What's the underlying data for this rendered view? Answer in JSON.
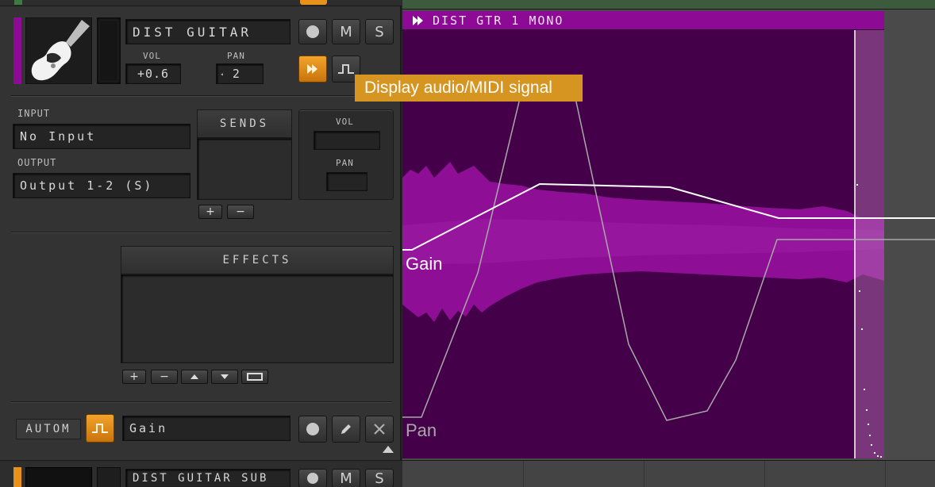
{
  "track": {
    "name": "DIST GUITAR",
    "vol_label": "VOL",
    "vol_value": "+0.6",
    "pan_label": "PAN",
    "pan_value": "2",
    "mute_label": "M",
    "solo_label": "S"
  },
  "tooltip": "Display audio/MIDI signal",
  "io": {
    "input_label": "INPUT",
    "input_value": "No Input",
    "output_label": "OUTPUT",
    "output_value": "Output 1-2 (S)"
  },
  "sends": {
    "title": "SENDS",
    "add": "+",
    "remove": "−",
    "vol_label": "VOL",
    "pan_label": "PAN"
  },
  "effects": {
    "title": "EFFECTS",
    "add": "+",
    "remove": "−"
  },
  "automation": {
    "label": "AUTOM",
    "parameter": "Gain"
  },
  "next_track": {
    "name": "DIST GUITAR SUB",
    "mute_label": "M",
    "solo_label": "S"
  },
  "clip": {
    "title": "DIST GTR 1 MONO",
    "gain_label": "Gain",
    "pan_label": "Pan"
  },
  "colors": {
    "accent_orange": "#e8921c",
    "clip_header": "#8c0a94",
    "clip_body": "#45004a",
    "waveform": "#8e0f96",
    "track_color": "#8c0a94",
    "next_track_color": "#e8921c"
  }
}
